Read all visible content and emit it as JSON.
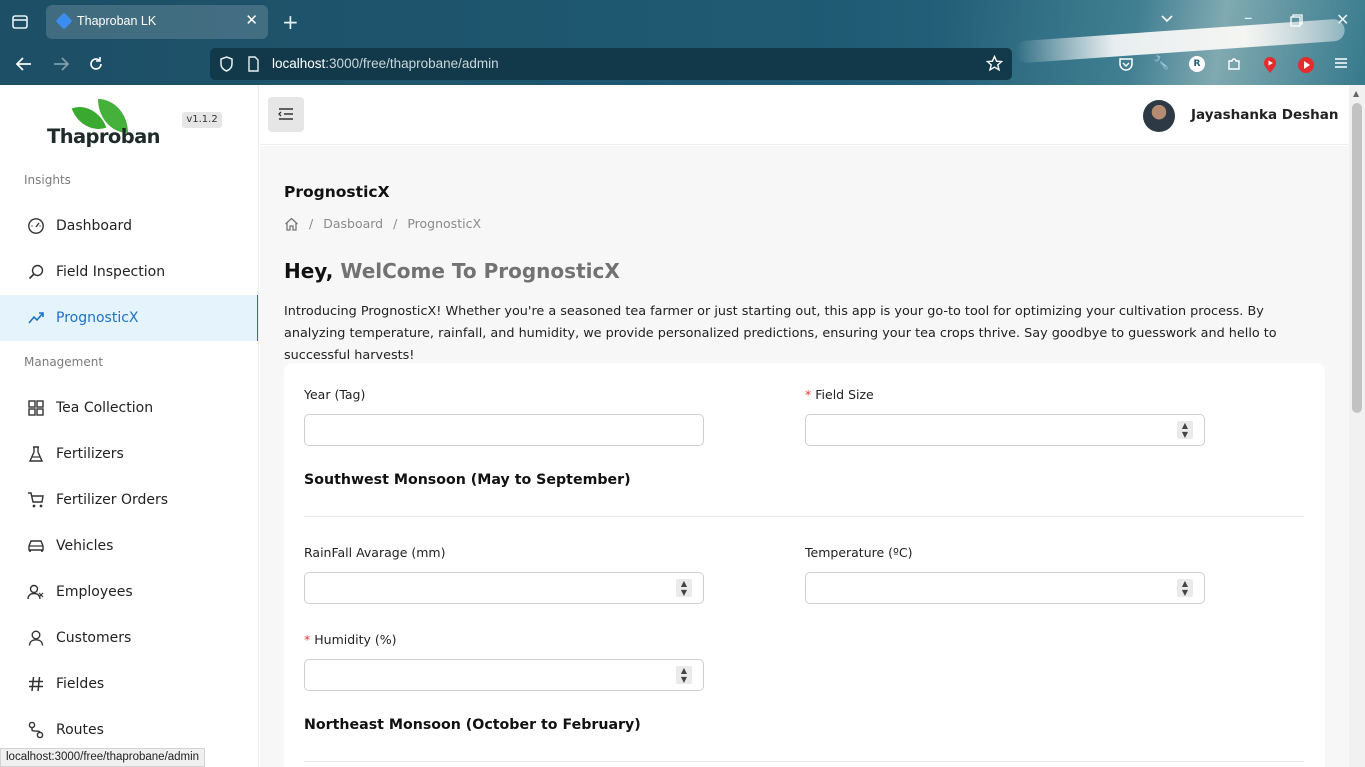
{
  "browser": {
    "tab_title": "Thaproban LK",
    "url_host": "localhost",
    "url_path": ":3000/free/thaprobane/admin",
    "status_url": "localhost:3000/free/thaprobane/admin"
  },
  "sidebar": {
    "logo_text": "Thaproban",
    "version": "v1.1.2",
    "sections": [
      "Insights",
      "Management"
    ],
    "items": [
      {
        "label": "Dashboard",
        "icon": "dashboard-icon"
      },
      {
        "label": "Field Inspection",
        "icon": "search-icon"
      },
      {
        "label": "PrognosticX",
        "icon": "trend-icon",
        "active": true
      },
      {
        "label": "Tea Collection",
        "icon": "grid-icon"
      },
      {
        "label": "Fertilizers",
        "icon": "flask-icon"
      },
      {
        "label": "Fertilizer Orders",
        "icon": "cart-icon"
      },
      {
        "label": "Vehicles",
        "icon": "car-icon"
      },
      {
        "label": "Employees",
        "icon": "users-icon"
      },
      {
        "label": "Customers",
        "icon": "user-icon"
      },
      {
        "label": "Fieldes",
        "icon": "hash-icon"
      },
      {
        "label": "Routes",
        "icon": "route-icon"
      }
    ]
  },
  "header": {
    "username": "Jayashanka Deshan"
  },
  "main": {
    "title": "PrognosticX",
    "breadcrumb": [
      "Dasboard",
      "PrognosticX"
    ],
    "hey": "Hey,",
    "welcome": "WelCome To PrognosticX",
    "intro": "Introducing PrognosticX! Whether you're a seasoned tea farmer or just starting out, this app is your go-to tool for optimizing your cultivation process. By analyzing temperature, rainfall, and humidity, we provide personalized predictions, ensuring your tea crops thrive. Say goodbye to guesswork and hello to successful harvests!"
  },
  "form": {
    "year_label": "Year (Tag)",
    "field_size_label": "Field Size",
    "sw_title": "Southwest Monsoon (May to September)",
    "rainfall_label": "RainFall Avarage (mm)",
    "temperature_label": "Temperature (ºC)",
    "humidity_label": "Humidity (%)",
    "ne_title": "Northeast Monsoon (October to February)",
    "required_mark": "*"
  },
  "colors": {
    "accent": "#1a73c8",
    "active_bg": "#e5f3fc",
    "required": "#e03a3a",
    "browser_bg": "#1f5a73"
  }
}
